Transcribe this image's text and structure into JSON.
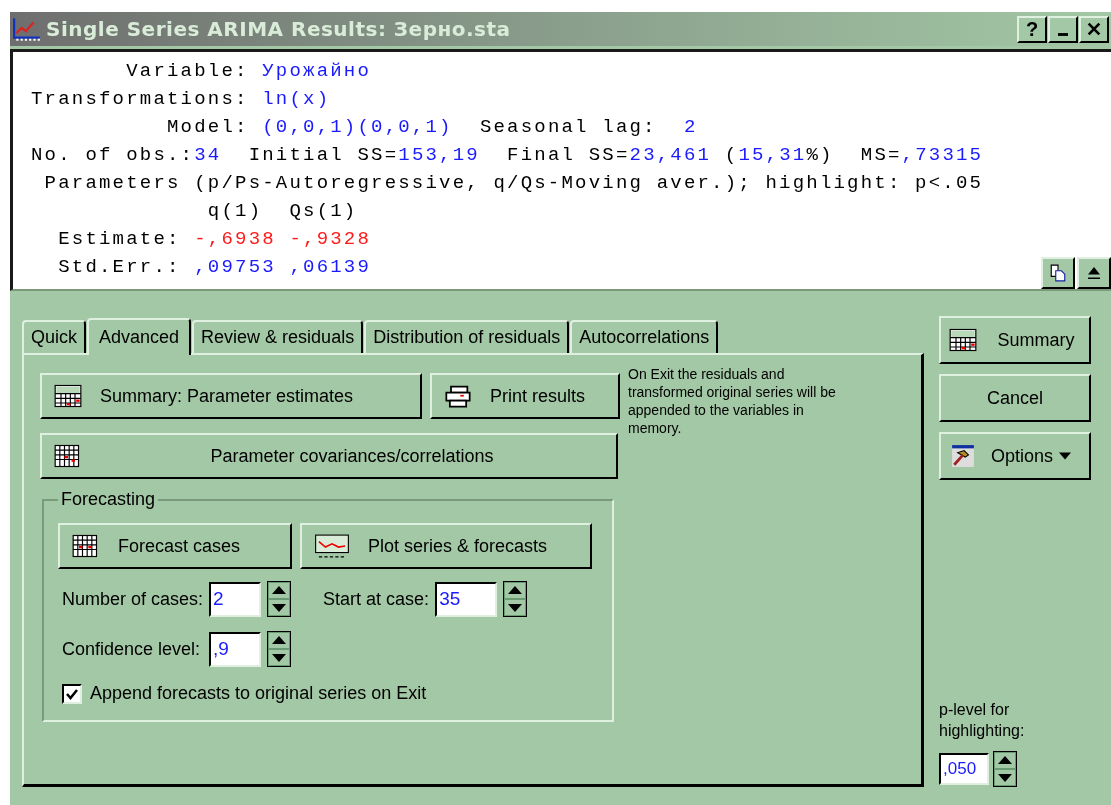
{
  "window": {
    "title": "Single Series ARIMA Results: Зерно.sta",
    "help_button": "?"
  },
  "results": {
    "lines": [
      {
        "segments": [
          {
            "text": "       Variable: ",
            "kind": "label"
          },
          {
            "text": "Урожайно",
            "kind": "value"
          }
        ]
      },
      {
        "segments": [
          {
            "text": "Transformations: ",
            "kind": "label"
          },
          {
            "text": "ln(x)",
            "kind": "value"
          }
        ]
      },
      {
        "segments": [
          {
            "text": "          Model: ",
            "kind": "label"
          },
          {
            "text": "(0,0,1)(0,0,1)",
            "kind": "value"
          },
          {
            "text": "  Seasonal lag:  ",
            "kind": "label"
          },
          {
            "text": "2",
            "kind": "value"
          }
        ]
      },
      {
        "segments": [
          {
            "text": "No. of obs.:",
            "kind": "label"
          },
          {
            "text": "34",
            "kind": "value"
          },
          {
            "text": "  Initial SS=",
            "kind": "label"
          },
          {
            "text": "153,19",
            "kind": "value"
          },
          {
            "text": "  Final SS=",
            "kind": "label"
          },
          {
            "text": "23,461",
            "kind": "value"
          },
          {
            "text": " (",
            "kind": "label"
          },
          {
            "text": "15,31",
            "kind": "value"
          },
          {
            "text": "%)  MS=",
            "kind": "label"
          },
          {
            "text": ",73315",
            "kind": "value"
          }
        ]
      },
      {
        "segments": [
          {
            "text": " Parameters (p/Ps-Autoregressive, q/Qs-Moving aver.); highlight: p<.05",
            "kind": "label"
          }
        ]
      },
      {
        "segments": [
          {
            "text": "             q(1)  Qs(1)",
            "kind": "label"
          }
        ]
      },
      {
        "segments": [
          {
            "text": "  Estimate: ",
            "kind": "label"
          },
          {
            "text": "-,6938",
            "kind": "highlight"
          },
          {
            "text": "-,9328",
            "kind": "highlight"
          }
        ]
      },
      {
        "segments": [
          {
            "text": "  Std.Err.: ",
            "kind": "label"
          },
          {
            "text": ",09753",
            "kind": "value"
          },
          {
            "text": ",06139",
            "kind": "value"
          }
        ]
      }
    ]
  },
  "tabs": [
    {
      "label": "Quick",
      "selected": false
    },
    {
      "label": "Advanced",
      "selected": true
    },
    {
      "label": "Review & residuals",
      "selected": false
    },
    {
      "label": "Distribution of residuals",
      "selected": false
    },
    {
      "label": "Autocorrelations",
      "selected": false
    }
  ],
  "advanced": {
    "summary_button": "Summary:  Parameter estimates",
    "print_button": "Print results",
    "covariances_button": "Parameter covariances/correlations",
    "note": "On Exit the residuals and transformed original series will be appended to the variables in memory.",
    "forecasting": {
      "title": "Forecasting",
      "forecast_button": "Forecast cases",
      "plot_button": "Plot series & forecasts",
      "number_of_cases": {
        "label": "Number of cases:",
        "value": "2"
      },
      "start_at_case": {
        "label": "Start at case:",
        "value": "35"
      },
      "confidence_level": {
        "label": "Confidence level:",
        "value": ",9"
      },
      "append": {
        "label": "Append forecasts to original series on Exit",
        "checked": true
      }
    }
  },
  "side": {
    "summary_button": "Summary",
    "cancel_button": "Cancel",
    "options_button": "Options",
    "p_level": {
      "label": "p-level for highlighting:",
      "value": ",050"
    }
  }
}
